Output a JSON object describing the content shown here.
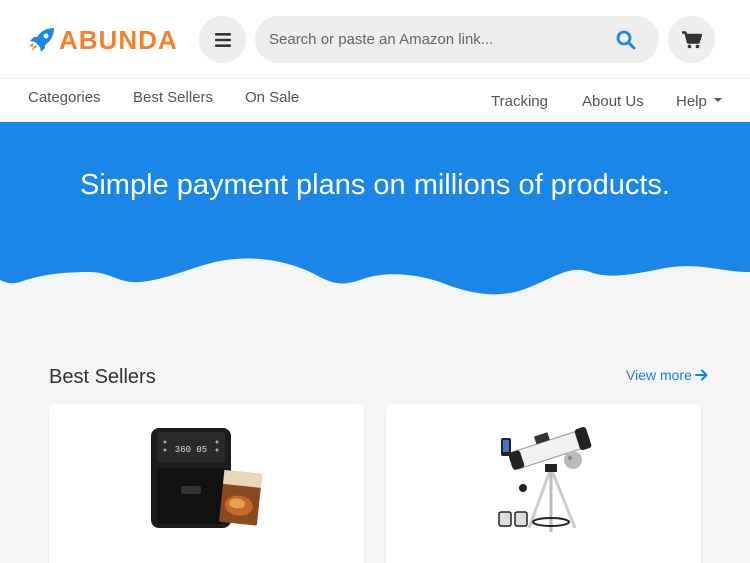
{
  "brand": {
    "name": "ABUNDA",
    "accent": "#f5822a",
    "primary": "#1a86e8"
  },
  "header": {
    "menu_icon": "hamburger-icon",
    "search": {
      "placeholder": "Search or paste an Amazon link...",
      "value": "",
      "icon": "search-icon"
    },
    "cart_icon": "cart-icon"
  },
  "nav": {
    "left": [
      {
        "label": "Categories"
      },
      {
        "label": "Best Sellers"
      },
      {
        "label": "On Sale"
      }
    ],
    "right": [
      {
        "label": "Tracking"
      },
      {
        "label": "About Us"
      },
      {
        "label": "Help"
      }
    ]
  },
  "hero": {
    "title": "Simple payment plans on millions of products."
  },
  "best_sellers": {
    "title": "Best Sellers",
    "view_more": "View more",
    "products": [
      {
        "image": "air-fryer-image"
      },
      {
        "image": "telescope-image"
      }
    ]
  }
}
